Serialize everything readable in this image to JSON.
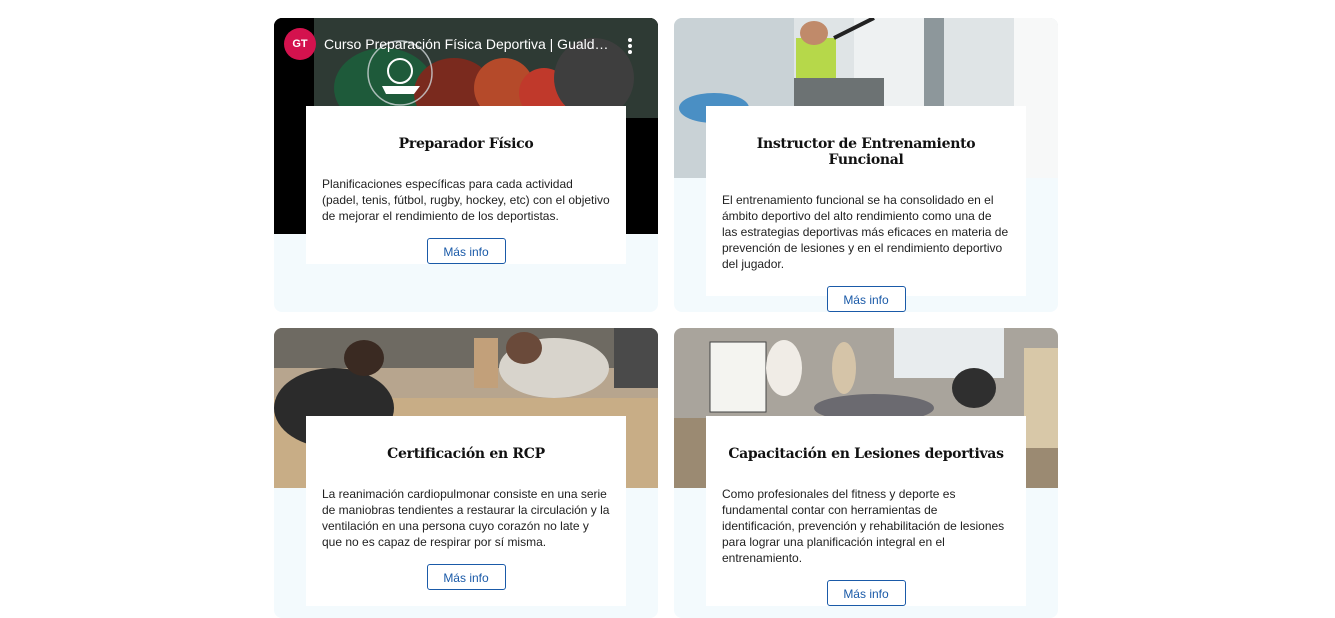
{
  "cards": [
    {
      "video": {
        "channel_logo": "GT",
        "title": "Curso Preparación Física Deportiva | Gualda ...",
        "menu_icon": "more-vert-icon"
      },
      "title": "Preparador Físico",
      "text": "Planificaciones específicas para cada actividad (padel, tenis, fútbol, rugby, hockey, etc) con el objetivo de mejorar el rendimiento de los deportistas.",
      "button": "Más info"
    },
    {
      "title": "Instructor de Entrenamiento Funcional",
      "text": "El entrenamiento funcional se ha consolidado en el ámbito deportivo del alto rendimiento como una de las estrategias deportivas más eficaces en materia de prevención de lesiones y en el rendimiento deportivo del jugador.",
      "button": "Más info"
    },
    {
      "title": "Certificación en RCP",
      "text": "La reanimación cardiopulmonar consiste en una serie de maniobras tendientes a restaurar la circulación y la ventilación en una persona cuyo corazón no late y que no es capaz de respirar por sí misma.",
      "button": "Más info"
    },
    {
      "title": "Capacitación en Lesiones deportivas",
      "text": "Como profesionales del fitness y deporte es fundamental contar con herramientas de identificación, prevención y rehabilitación de lesiones para lograr una planificación integral en el entrenamiento.",
      "button": "Más info"
    }
  ],
  "colors": {
    "accent": "#1a5aa8",
    "card_bg": "#f3fafd",
    "logo": "#d4124e"
  }
}
